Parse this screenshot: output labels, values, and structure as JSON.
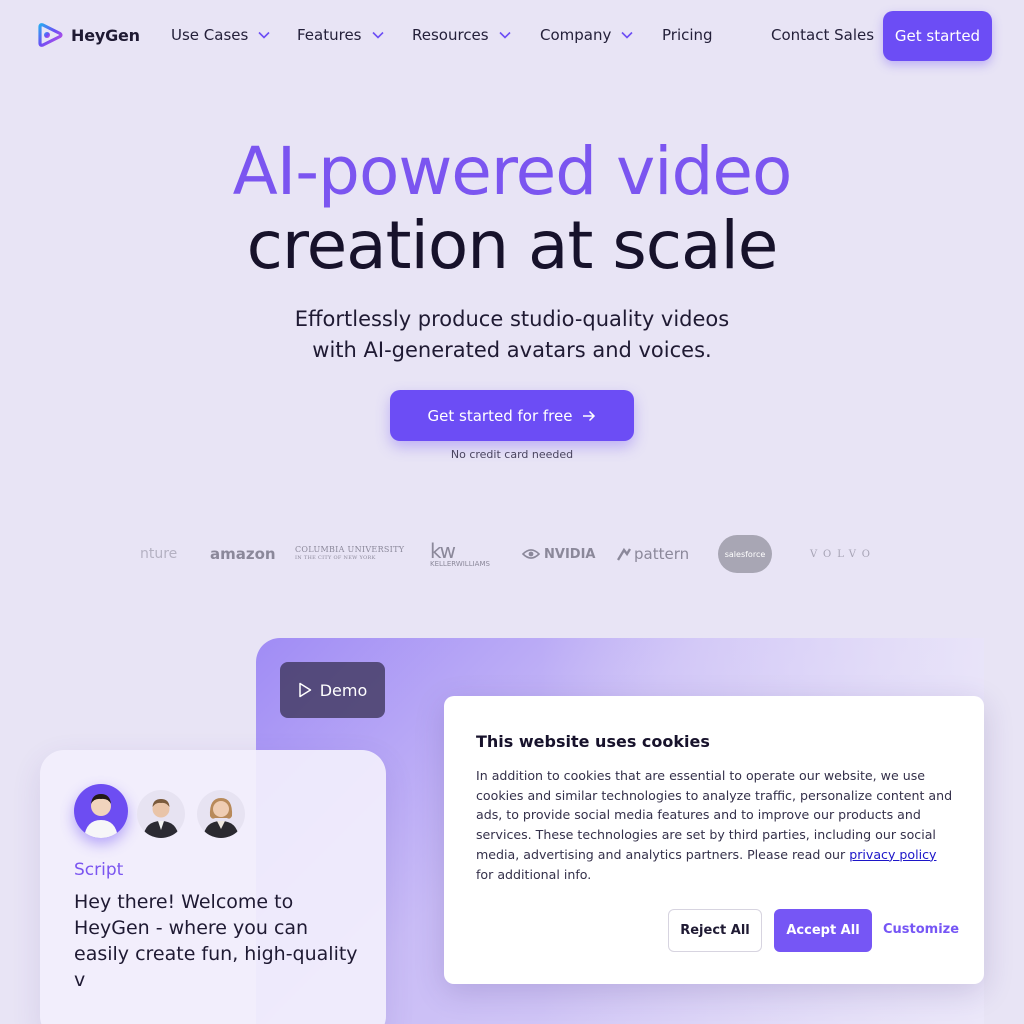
{
  "nav": {
    "brand": "HeyGen",
    "items": [
      {
        "label": "Use Cases",
        "has_dropdown": true
      },
      {
        "label": "Features",
        "has_dropdown": true
      },
      {
        "label": "Resources",
        "has_dropdown": true
      },
      {
        "label": "Company",
        "has_dropdown": true
      },
      {
        "label": "Pricing",
        "has_dropdown": false
      }
    ],
    "contact": "Contact Sales",
    "get_started": "Get started"
  },
  "hero": {
    "line1": "AI-powered video",
    "line2": "creation at scale",
    "sub1": "Effortlessly produce studio-quality videos",
    "sub2": "with AI-generated avatars and voices.",
    "cta": "Get started for free",
    "note": "No credit card needed"
  },
  "logos": {
    "accenture": "nture",
    "amazon": "amazon",
    "columbia1": "COLUMBIA UNIVERSITY",
    "columbia2": "IN THE CITY OF NEW YORK",
    "kw": "kw",
    "kw_name": "KELLERWILLIAMS",
    "nvidia": "NVIDIA",
    "pattern": "pattern",
    "salesforce": "salesforce",
    "volvo": "VOLVO"
  },
  "demo": {
    "button": "Demo",
    "script_label": "Script",
    "script_text": "Hey there! Welcome to HeyGen - where you can easily create fun, high-quality v"
  },
  "cookie": {
    "title": "This website uses cookies",
    "body_before": "In addition to cookies that are essential to operate our website, we use cookies and similar technologies to analyze traffic, personalize content and ads, to provide social media features and to improve our products and services. These technologies are set by third parties, including our social media, advertising and analytics partners. Please read our ",
    "link": "privacy policy",
    "body_after": " for additional info.",
    "reject": "Reject All",
    "accept": "Accept All",
    "customize": "Customize"
  },
  "colors": {
    "accent": "#6c4df5",
    "hero_purple": "#7b55f0",
    "link": "#1c15c8",
    "background": "#e8e4f5"
  }
}
